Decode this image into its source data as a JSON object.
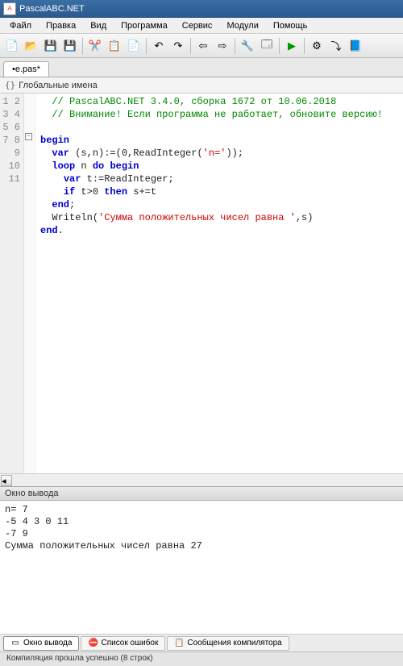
{
  "window": {
    "title": "PascalABC.NET"
  },
  "menu": {
    "file": "Файл",
    "edit": "Правка",
    "view": "Вид",
    "program": "Программа",
    "service": "Сервис",
    "modules": "Модули",
    "help": "Помощь"
  },
  "tab": {
    "name": "•e.pas*"
  },
  "scope": {
    "label": "Глобальные имена"
  },
  "gutter": [
    "1",
    "2",
    "3",
    "4",
    "5",
    "6",
    "7",
    "8",
    "9",
    "10",
    "11"
  ],
  "code": {
    "l1_comment": "// PascalABC.NET 3.4.0, сборка 1672 от 10.06.2018",
    "l2_comment": "// Внимание! Если программа не работает, обновите версию!",
    "l4_begin": "begin",
    "l5_var": "var",
    "l5_rest": " (s,n):=(0,ReadInteger(",
    "l5_str": "'n='",
    "l5_tail": "));",
    "l6_loop": "loop",
    "l6_mid": " n ",
    "l6_do": "do",
    "l6_begin": "begin",
    "l7_var": "var",
    "l7_rest": " t:=ReadInteger;",
    "l8_if": "if",
    "l8_mid": " t>0 ",
    "l8_then": "then",
    "l8_rest": " s+=t",
    "l9_end": "end",
    "l9_semi": ";",
    "l10_fn": "Writeln(",
    "l10_str": "'Сумма положительных чисел равна '",
    "l10_tail": ",s)",
    "l11_end": "end",
    "l11_dot": "."
  },
  "output_panel": {
    "title": "Окно вывода"
  },
  "output": {
    "l1": "n= 7",
    "l2": "-5 4 3 0 11",
    "l3": "-7 9",
    "l4": "Сумма положительных чисел равна 27"
  },
  "bottom_tabs": {
    "output": "Окно вывода",
    "errors": "Список ошибок",
    "compiler": "Сообщения компилятора"
  },
  "status": {
    "text": "Компиляция прошла успешно (8 строк)"
  }
}
